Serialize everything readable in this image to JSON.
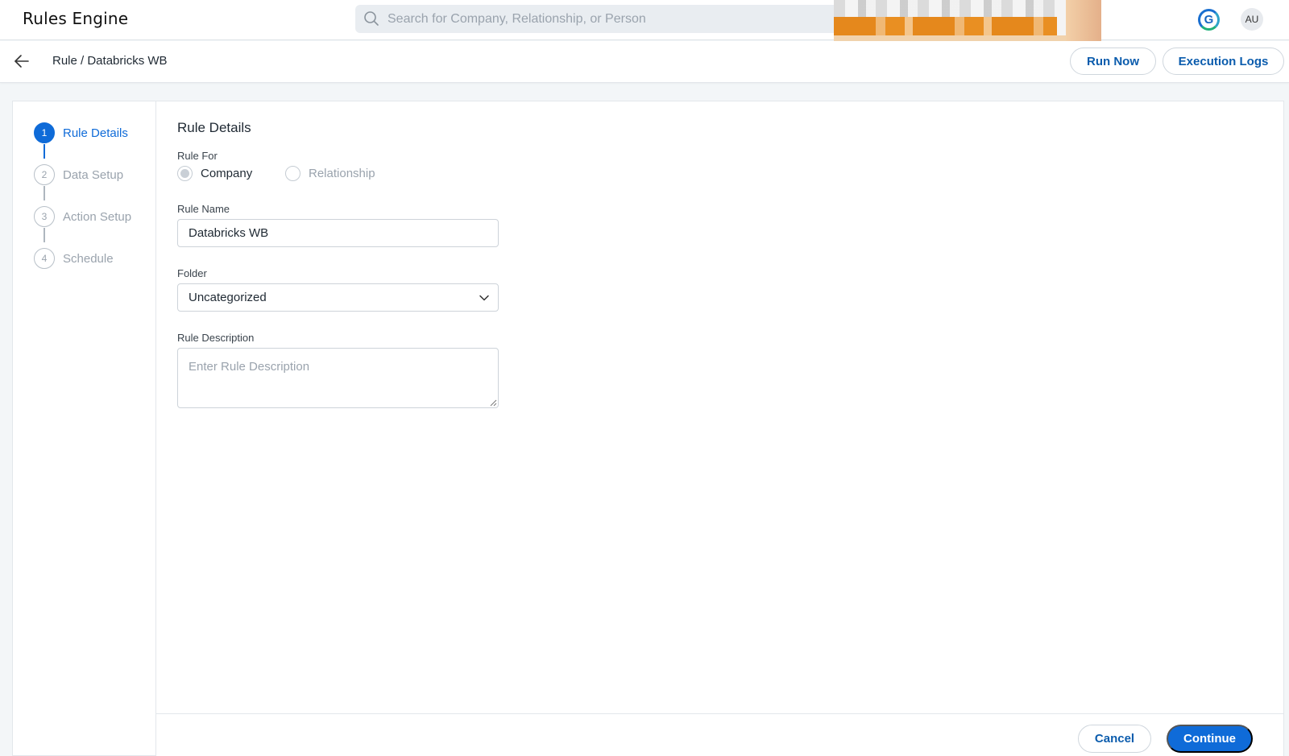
{
  "app": {
    "title": "Rules Engine",
    "logo_letter": "G",
    "avatar_initials": "AU"
  },
  "search": {
    "placeholder": "Search for Company, Relationship, or Person"
  },
  "header": {
    "breadcrumb": "Rule / Databricks WB",
    "run_now_label": "Run Now",
    "execution_logs_label": "Execution Logs"
  },
  "stepper": {
    "steps": [
      {
        "number": "1",
        "label": "Rule Details",
        "active": true
      },
      {
        "number": "2",
        "label": "Data Setup",
        "active": false
      },
      {
        "number": "3",
        "label": "Action Setup",
        "active": false
      },
      {
        "number": "4",
        "label": "Schedule",
        "active": false
      }
    ]
  },
  "form": {
    "title": "Rule Details",
    "rule_for_label": "Rule For",
    "rule_for_options": [
      {
        "label": "Company",
        "selected": true
      },
      {
        "label": "Relationship",
        "selected": false
      }
    ],
    "rule_name_label": "Rule Name",
    "rule_name_value": "Databricks WB",
    "folder_label": "Folder",
    "folder_value": "Uncategorized",
    "description_label": "Rule Description",
    "description_placeholder": "Enter Rule Description"
  },
  "footer": {
    "cancel_label": "Cancel",
    "continue_label": "Continue"
  },
  "colors": {
    "primary": "#0f6bd8",
    "link": "#0b5cad",
    "muted": "#9aa3ad"
  },
  "icons": {
    "search": "search-icon",
    "back": "arrow-left-icon",
    "dropdown": "chevron-down-icon"
  }
}
